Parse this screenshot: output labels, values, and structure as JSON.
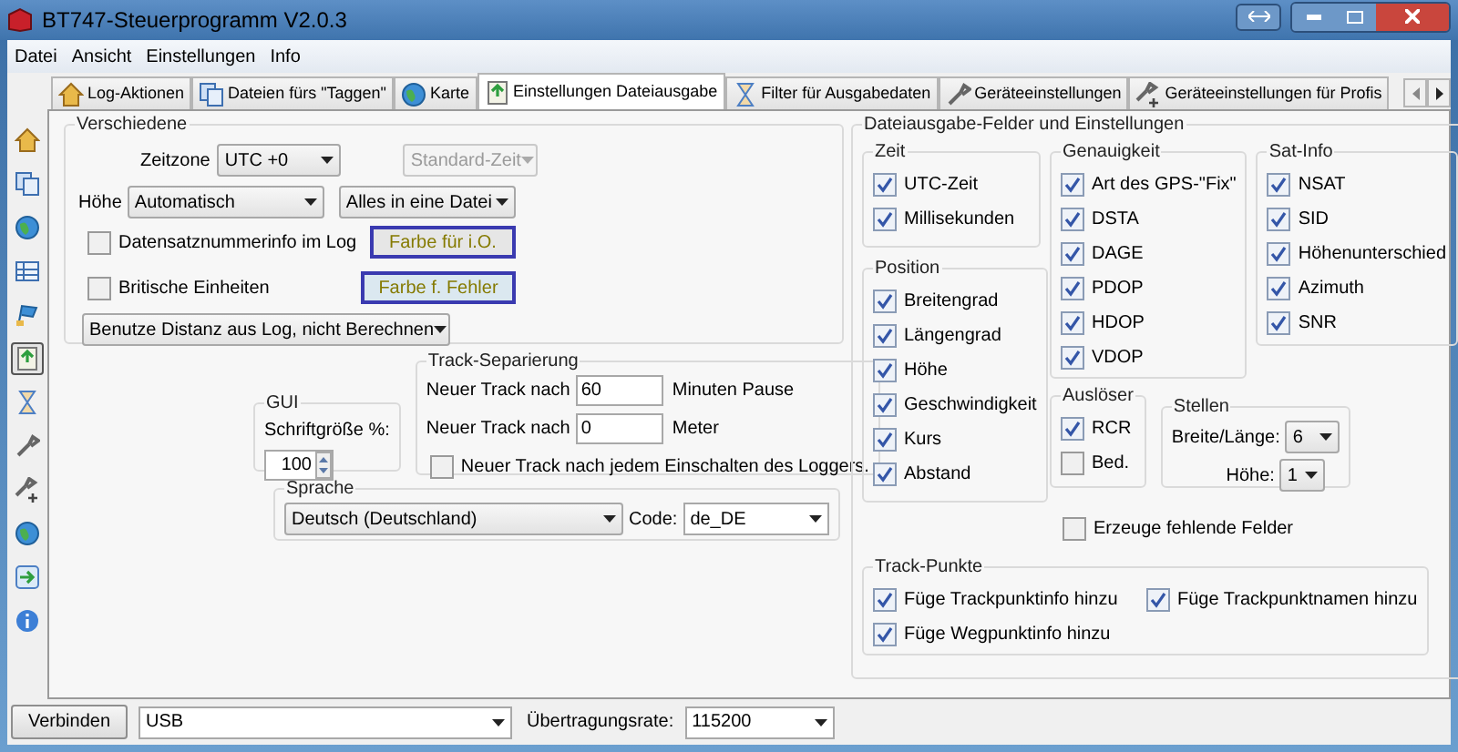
{
  "window": {
    "title": "BT747-Steuerprogramm V2.0.3"
  },
  "menu": [
    "Datei",
    "Ansicht",
    "Einstellungen",
    "Info"
  ],
  "tabs": [
    {
      "label": "Log-Aktionen",
      "kind": "home",
      "selected": false
    },
    {
      "label": "Dateien fürs \"Taggen\"",
      "kind": "files",
      "selected": false
    },
    {
      "label": "Karte",
      "kind": "globe",
      "selected": false
    },
    {
      "label": "Einstellungen Dateiausgabe",
      "kind": "export",
      "selected": true
    },
    {
      "label": "Filter für Ausgabedaten",
      "kind": "hourglass",
      "selected": false
    },
    {
      "label": "Geräteeinstellungen",
      "kind": "wrench",
      "selected": false
    },
    {
      "label": "Geräteeinstellungen für Profis",
      "kind": "wrenchplus",
      "selected": false
    }
  ],
  "sidebar": [
    {
      "kind": "home",
      "selected": false
    },
    {
      "kind": "files",
      "selected": false
    },
    {
      "kind": "globe",
      "selected": false
    },
    {
      "kind": "table",
      "selected": false
    },
    {
      "kind": "flag",
      "selected": false
    },
    {
      "kind": "export",
      "selected": true
    },
    {
      "kind": "hourglass",
      "selected": false
    },
    {
      "kind": "wrench",
      "selected": false
    },
    {
      "kind": "wrenchplus",
      "selected": false
    },
    {
      "kind": "globe",
      "selected": false
    },
    {
      "kind": "arrow",
      "selected": false
    },
    {
      "kind": "info",
      "selected": false
    }
  ],
  "misc": {
    "title": "Verschiedene",
    "timezone_label": "Zeitzone",
    "timezone": "UTC +0",
    "standard_time": {
      "value": "Standard-Zeit",
      "disabled": true
    },
    "height_label": "Höhe",
    "height": "Automatisch",
    "file_mode": "Alles in eine Datei",
    "checkboxes": [
      {
        "label": "Datensatznummerinfo im Log",
        "checked": false
      },
      {
        "label": "Britische Einheiten",
        "checked": false
      }
    ],
    "color_buttons": [
      "Farbe für i.O.",
      "Farbe f. Fehler"
    ],
    "distance": "Benutze Distanz aus Log, nicht Berechnen"
  },
  "track_separation": {
    "title": "Track-Separierung",
    "rows": [
      {
        "label": "Neuer Track nach",
        "value": "60",
        "unit": "Minuten Pause"
      },
      {
        "label": "Neuer Track nach",
        "value": "0",
        "unit": "Meter"
      }
    ],
    "checkbox": {
      "label": "Neuer Track nach jedem Einschalten des Loggers.",
      "checked": false
    }
  },
  "gui": {
    "title": "GUI",
    "label": "Schriftgröße %:",
    "value": "100"
  },
  "language": {
    "title": "Sprache",
    "value": "Deutsch (Deutschland)",
    "code_label": "Code:",
    "code": "de_DE"
  },
  "output": {
    "title": "Dateiausgabe-Felder und Einstellungen",
    "time": {
      "title": "Zeit",
      "items": [
        {
          "label": "UTC-Zeit",
          "checked": true
        },
        {
          "label": "Millisekunden",
          "checked": true
        }
      ]
    },
    "position": {
      "title": "Position",
      "items": [
        {
          "label": "Breitengrad",
          "checked": true
        },
        {
          "label": "Längengrad",
          "checked": true
        },
        {
          "label": "Höhe",
          "checked": true
        },
        {
          "label": "Geschwindigkeit",
          "checked": true
        },
        {
          "label": "Kurs",
          "checked": true
        },
        {
          "label": "Abstand",
          "checked": true
        }
      ]
    },
    "accuracy": {
      "title": "Genauigkeit",
      "items": [
        {
          "label": "Art des GPS-\"Fix\"",
          "checked": true
        },
        {
          "label": "DSTA",
          "checked": true
        },
        {
          "label": "DAGE",
          "checked": true
        },
        {
          "label": "PDOP",
          "checked": true
        },
        {
          "label": "HDOP",
          "checked": true
        },
        {
          "label": "VDOP",
          "checked": true
        }
      ]
    },
    "sat_info": {
      "title": "Sat-Info",
      "items": [
        {
          "label": "NSAT",
          "checked": true
        },
        {
          "label": "SID",
          "checked": true
        },
        {
          "label": "Höhenunterschied",
          "checked": true
        },
        {
          "label": "Azimuth",
          "checked": true
        },
        {
          "label": "SNR",
          "checked": true
        }
      ]
    },
    "trigger": {
      "title": "Auslöser",
      "items": [
        {
          "label": "RCR",
          "checked": true
        },
        {
          "label": "Bed.",
          "checked": false
        }
      ]
    },
    "digits": {
      "title": "Stellen",
      "rows": [
        {
          "label": "Breite/Länge:",
          "value": "6"
        },
        {
          "label": "Höhe:",
          "value": "1"
        }
      ]
    },
    "missing_fields": {
      "label": "Erzeuge fehlende Felder",
      "checked": false
    },
    "track_points": {
      "title": "Track-Punkte",
      "items": [
        {
          "label": "Füge Trackpunktinfo hinzu",
          "checked": true
        },
        {
          "label": "Füge Trackpunktnamen hinzu",
          "checked": true
        },
        {
          "label": "Füge Wegpunktinfo hinzu",
          "checked": true
        }
      ]
    }
  },
  "bottom": {
    "connect": "Verbinden",
    "port": "USB",
    "rate_label": "Übertragungsrate:",
    "rate": "115200"
  }
}
